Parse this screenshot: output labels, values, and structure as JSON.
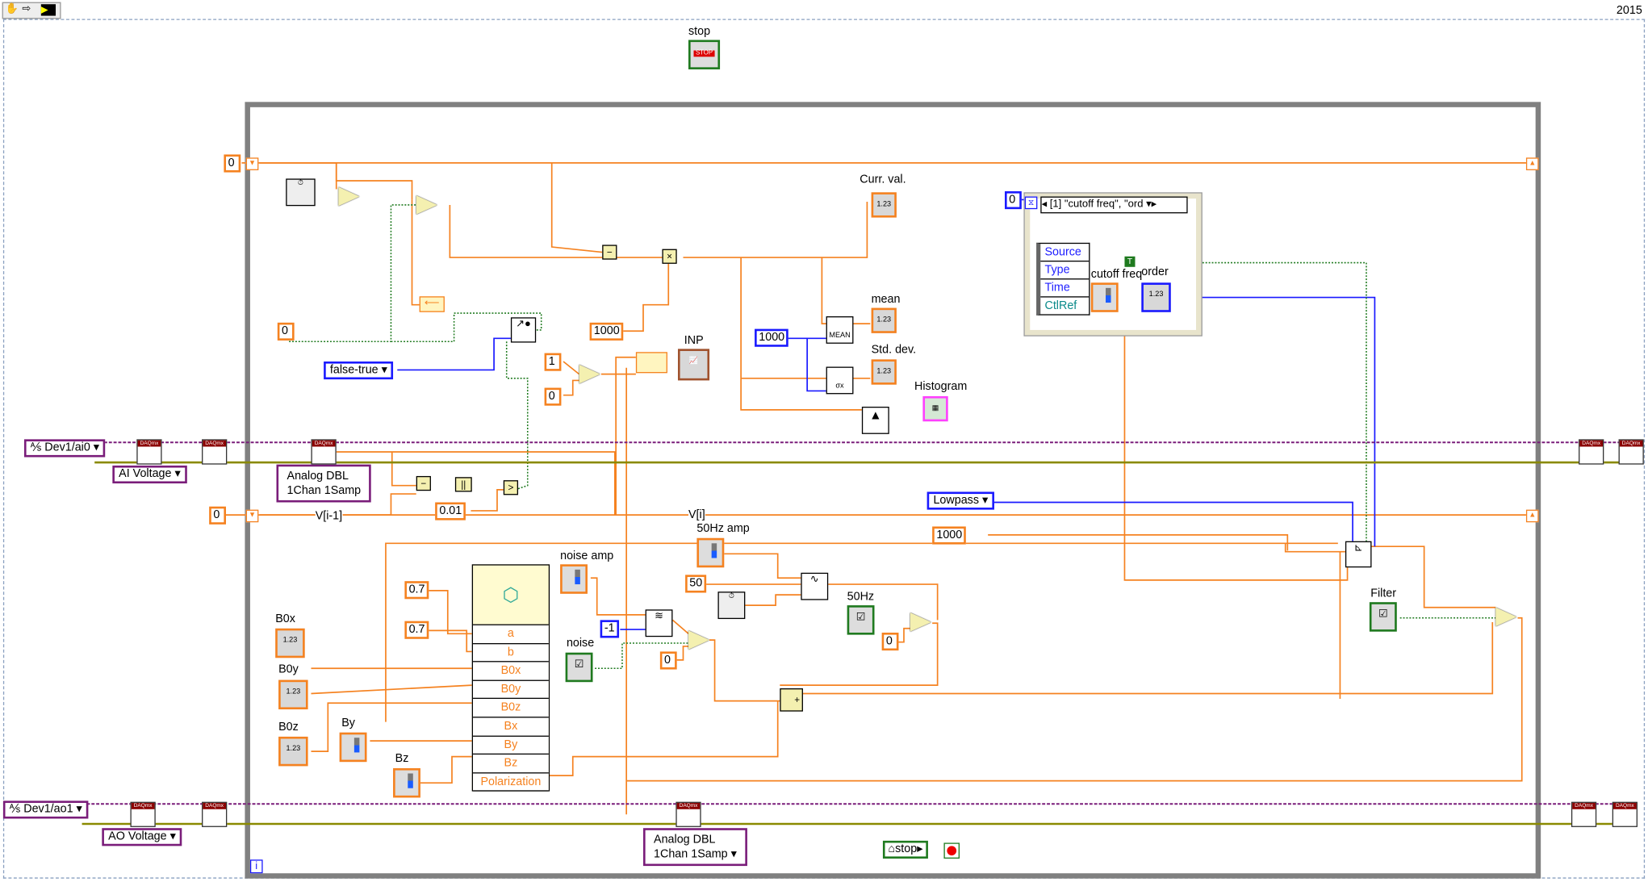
{
  "version": "2015",
  "stop_control": {
    "label": "stop"
  },
  "loop_stop_local": {
    "label": "stop"
  },
  "loop_iteration": "i",
  "constants": {
    "top_shift_init": "0",
    "reset_init": "0",
    "ms_1000": "1000",
    "sel_one": "1",
    "sel_zero": "0",
    "vi_init": "0",
    "threshold": "0.01",
    "stats_samples": "1000",
    "filter_fs": "1000",
    "hz50": "50",
    "noise_seed": "-1",
    "noise_zero": "0",
    "hz50_zero": "0",
    "a_value": "0.7",
    "b_value": "0.7",
    "event_timeout": "0"
  },
  "enums": {
    "false_true": "false-true",
    "filter_type": "Lowpass",
    "ai_voltage": "AI Voltage",
    "ao_voltage": "AO Voltage",
    "read_mode": "Analog DBL\n1Chan 1Samp",
    "write_mode": "Analog DBL\n1Chan 1Samp"
  },
  "channels": {
    "ai": "Dev1/ai0",
    "ao": "Dev1/ao1"
  },
  "wire_labels": {
    "v_prev": "V[i-1]",
    "v_curr": "V[i]"
  },
  "indicators": {
    "curr_val": "Curr. val.",
    "mean": "mean",
    "std_dev": "Std. dev.",
    "histogram": "Histogram",
    "inp": "INP"
  },
  "controls": {
    "b0x": "B0x",
    "b0y": "B0y",
    "b0z": "B0z",
    "by": "By",
    "bz": "Bz",
    "noise_amp": "noise amp",
    "noise": "noise",
    "amp50": "50Hz amp",
    "hz50": "50Hz",
    "filter": "Filter",
    "cutoff": "cutoff freq",
    "order": "order"
  },
  "formula_node": {
    "inputs": [
      "a",
      "b",
      "B0x",
      "B0y",
      "B0z",
      "Bx",
      "By",
      "Bz"
    ],
    "output": "Polarization"
  },
  "event_structure": {
    "selector": "[1] \"cutoff freq\", \"ord",
    "data_items": [
      "Source",
      "Type",
      "Time",
      "CtlRef"
    ]
  },
  "nodes": {
    "mean": "MEAN",
    "std": "σx"
  },
  "colors": {
    "dbl_wire": "#f58220",
    "int_wire": "#1a1aff",
    "bool_wire": "#1f7a1f",
    "task_wire": "#7a1d7a",
    "error_wire": "#8a8a00",
    "loop_border": "#808080"
  }
}
